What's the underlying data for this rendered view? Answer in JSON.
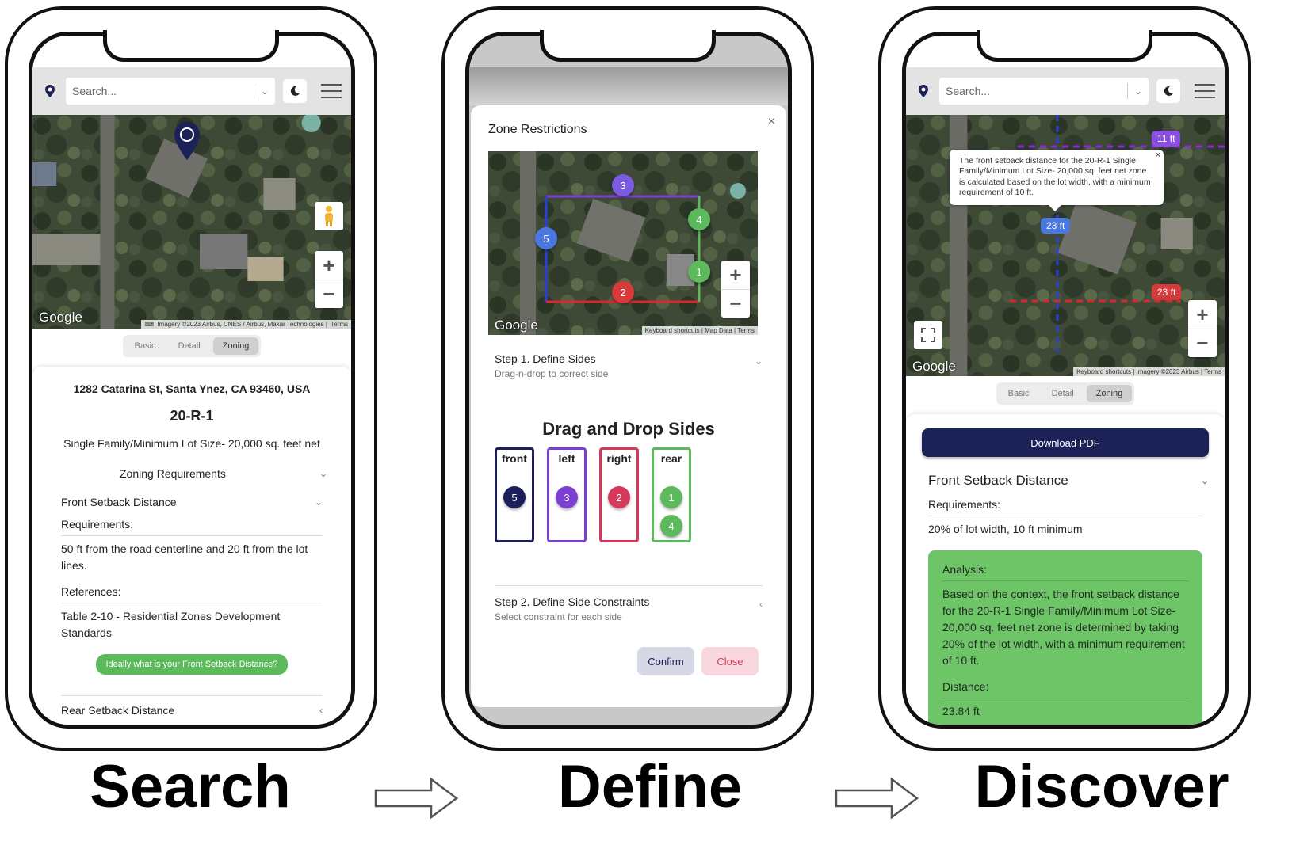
{
  "phone1": {
    "search_placeholder": "Search...",
    "map": {
      "google": "Google",
      "attribution": "Imagery ©2023 Airbus, CNES / Airbus, Maxar Technologies",
      "terms": "Terms",
      "zoom_in": "+",
      "zoom_out": "−"
    },
    "tabs": [
      "Basic",
      "Detail",
      "Zoning"
    ],
    "address": "1282 Catarina St, Santa Ynez, CA 93460, USA",
    "zone_code": "20-R-1",
    "zone_desc": "Single Family/Minimum Lot Size- 20,000 sq. feet net",
    "zoning_requirements": "Zoning Requirements",
    "front_setback": "Front Setback Distance",
    "requirements_label": "Requirements:",
    "requirements_text": "50 ft from the road centerline and 20 ft from the lot lines.",
    "references_label": "References:",
    "references_text": "Table 2-10 - Residential Zones Development Standards",
    "ask_button": "Ideally what is your Front Setback Distance?",
    "rear_setback": "Rear Setback Distance"
  },
  "phone2": {
    "modal_title": "Zone Restrictions",
    "close": "×",
    "map": {
      "google": "Google",
      "attribution_keys": "Keyboard shortcuts",
      "attribution_data": "Map Data",
      "terms": "Terms",
      "zoom_in": "+",
      "zoom_out": "−"
    },
    "markers": [
      "3",
      "4",
      "5",
      "1",
      "2"
    ],
    "step1_title": "Step 1. Define Sides",
    "step1_sub": "Drag-n-drop to correct side",
    "dnd_title": "Drag and Drop Sides",
    "buckets": [
      {
        "label": "front",
        "chips": [
          "5"
        ]
      },
      {
        "label": "left",
        "chips": [
          "3"
        ]
      },
      {
        "label": "right",
        "chips": [
          "2"
        ]
      },
      {
        "label": "rear",
        "chips": [
          "1",
          "4"
        ]
      }
    ],
    "step2_title": "Step 2. Define Side Constraints",
    "step2_sub": "Select constraint for each side",
    "confirm": "Confirm",
    "close_btn": "Close"
  },
  "phone3": {
    "search_placeholder": "Search...",
    "map": {
      "google": "Google",
      "attribution_keys": "Keyboard shortcuts",
      "attribution_imagery": "Imagery ©2023 Airbus",
      "terms": "Terms",
      "zoom_in": "+",
      "zoom_out": "−"
    },
    "tooltip": "The front setback distance for the 20-R-1 Single Family/Minimum Lot Size- 20,000 sq. feet net zone is calculated based on the lot width, with a minimum requirement of 10 ft.",
    "tag_top": "11 ft",
    "tag_mid": "23 ft",
    "tag_right": "23 ft",
    "tabs": [
      "Basic",
      "Detail",
      "Zoning"
    ],
    "download": "Download PDF",
    "front_setback": "Front Setback Distance",
    "requirements_label": "Requirements:",
    "requirements_text": "20% of lot width, 10 ft minimum",
    "analysis_label": "Analysis:",
    "analysis_text": "Based on the context, the front setback distance for the 20-R-1 Single Family/Minimum Lot Size- 20,000 sq. feet net zone is determined by taking 20% of the lot width, with a minimum requirement of 10 ft.",
    "distance_label": "Distance:",
    "distance_value": "23.84 ft"
  },
  "captions": {
    "search": "Search",
    "define": "Define",
    "discover": "Discover"
  },
  "colors": {
    "front": "#1c1f5a",
    "left": "#7b3fd1",
    "right": "#d63a5a",
    "rear": "#5cba5c",
    "download": "#1c2158",
    "analysis_bg": "#6ec568"
  }
}
